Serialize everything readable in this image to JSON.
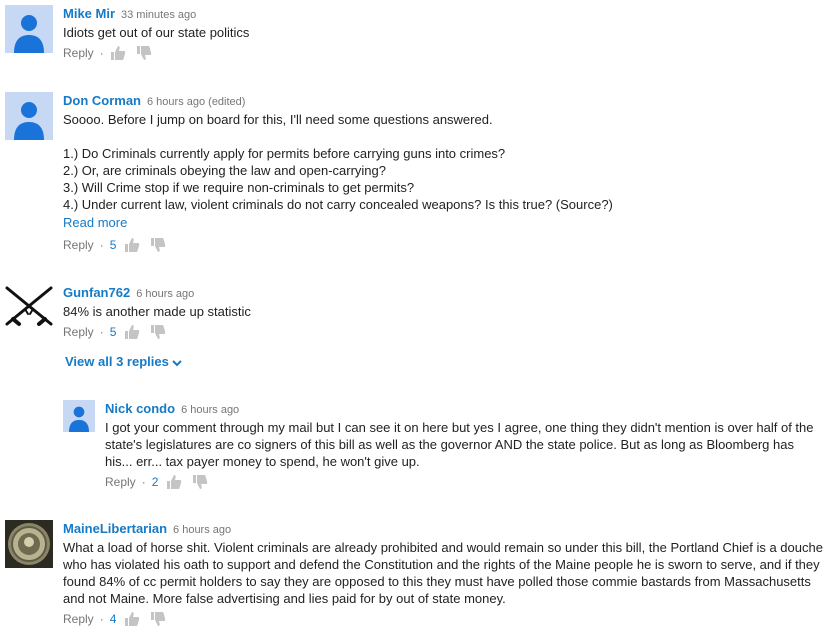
{
  "colors": {
    "link": "#167ac6",
    "meta": "#767676",
    "text": "#222222"
  },
  "icons": {
    "like": "thumbs-up-icon",
    "dislike": "thumbs-down-icon",
    "expand": "chevron-down-icon"
  },
  "comments": [
    {
      "author": "Mike Mir",
      "time": "33 minutes ago",
      "text": "Idiots get out of our state politics",
      "reply_label": "Reply",
      "separator": "·",
      "likes": ""
    },
    {
      "author": "Don Corman",
      "time": "6 hours ago (edited)",
      "text": "Soooo. Before I jump on board for this, I'll need some questions answered.\n\n1.) Do Criminals currently apply for permits before carrying guns into crimes?\n2.) Or, are criminals obeying the law and open-carrying?\n3.) Will Crime stop if we require non-criminals to get permits?\n4.) Under current law, violent criminals do not carry concealed weapons? Is this true? (Source?)",
      "read_more": "Read more",
      "reply_label": "Reply",
      "separator": "·",
      "likes": "5"
    },
    {
      "author": "Gunfan762",
      "time": "6 hours ago",
      "text": "84% is another made up statistic",
      "reply_label": "Reply",
      "separator": "·",
      "likes": "5",
      "view_replies": "View all 3 replies"
    },
    {
      "author": "Nick condo",
      "time": "6 hours ago",
      "text": "I got your comment through my mail but I can see it on here but yes I agree, one thing they didn't mention is over half of the state's legislatures are co signers of this bill as well as the governor AND the state police. But as long as Bloomberg has his... err... tax payer money to spend, he won't give up.",
      "reply_label": "Reply",
      "separator": "·",
      "likes": "2"
    },
    {
      "author": "MaineLibertarian",
      "time": "6 hours ago",
      "text": "What a load of horse shit.  Violent criminals are already prohibited and would remain so under this bill, the Portland Chief is a douche who has violated his oath to support and defend the Constitution and the rights of the Maine people he is sworn to serve, and if they found 84% of cc permit holders to say they are opposed to this they must have polled those commie bastards from Massachusetts and not Maine.  More false advertising and lies paid for by out of state money.",
      "reply_label": "Reply",
      "separator": "·",
      "likes": "4"
    }
  ]
}
